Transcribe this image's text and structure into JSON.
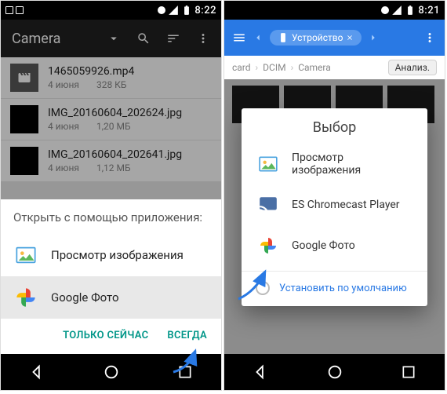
{
  "left": {
    "status": {
      "time": "8:22"
    },
    "appbar": {
      "title": "Camera"
    },
    "files": [
      {
        "name": "1465059926.mp4",
        "date": "4 июня",
        "size": "328 КБ"
      },
      {
        "name": "IMG_20160604_202624.jpg",
        "date": "4 июня",
        "size": "1,20 МБ"
      },
      {
        "name": "IMG_20160604_202641.jpg",
        "date": "4 июня",
        "size": "1,12 МБ"
      }
    ],
    "sheet": {
      "title": "Открыть с помощью приложения:",
      "items": [
        {
          "label": "Просмотр изображения"
        },
        {
          "label": "Google Фото"
        }
      ],
      "actions": {
        "once": "ТОЛЬКО СЕЙЧАС",
        "always": "ВСЕГДА"
      }
    }
  },
  "right": {
    "status": {
      "time": "8:21"
    },
    "es": {
      "tag": "Устройство",
      "crumbs": [
        "card",
        "DCIM",
        "Camera"
      ],
      "analyze": "Анализ."
    },
    "dialog": {
      "title": "Выбор",
      "items": [
        {
          "label": "Просмотр изображения"
        },
        {
          "label": "ES Chromecast Player"
        },
        {
          "label": "Google Фото"
        }
      ],
      "default": "Установить по умолчанию"
    }
  }
}
